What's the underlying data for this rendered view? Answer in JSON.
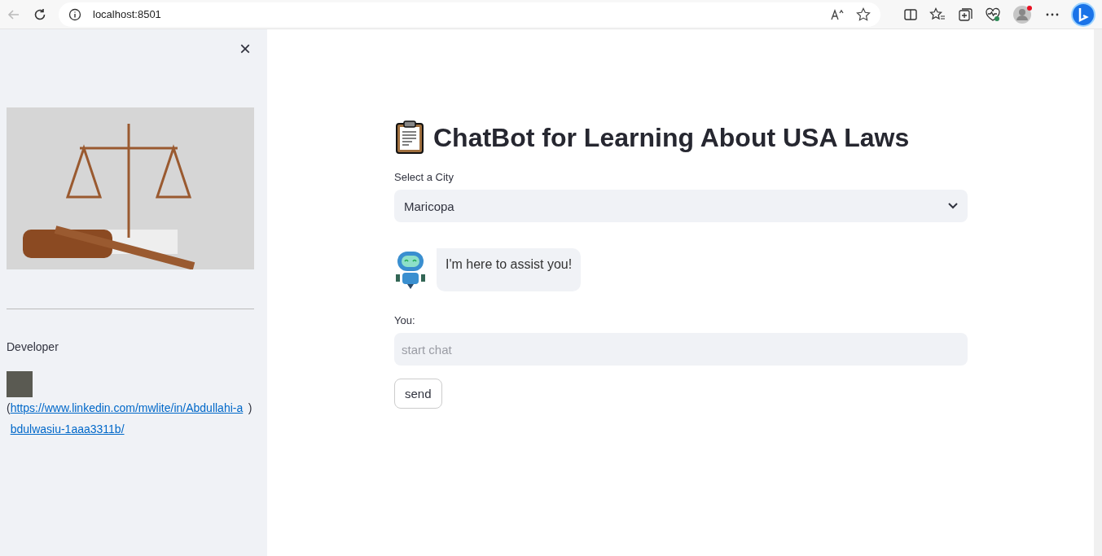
{
  "browser": {
    "url": "localhost:8501"
  },
  "sidebar": {
    "close": "×",
    "developer_label": "Developer",
    "link_open": "(",
    "link": "https://www.linkedin.com/mwlite/in/Abdullahi-abdulwasiu-1aaa3311b/",
    "link_close": ")"
  },
  "main": {
    "title": "ChatBot for Learning About USA Laws",
    "city_label": "Select a City",
    "city_value": "Maricopa",
    "bot_message": "I'm here to assist you!",
    "you_label": "You:",
    "input_placeholder": "start chat",
    "send_button": "send"
  }
}
